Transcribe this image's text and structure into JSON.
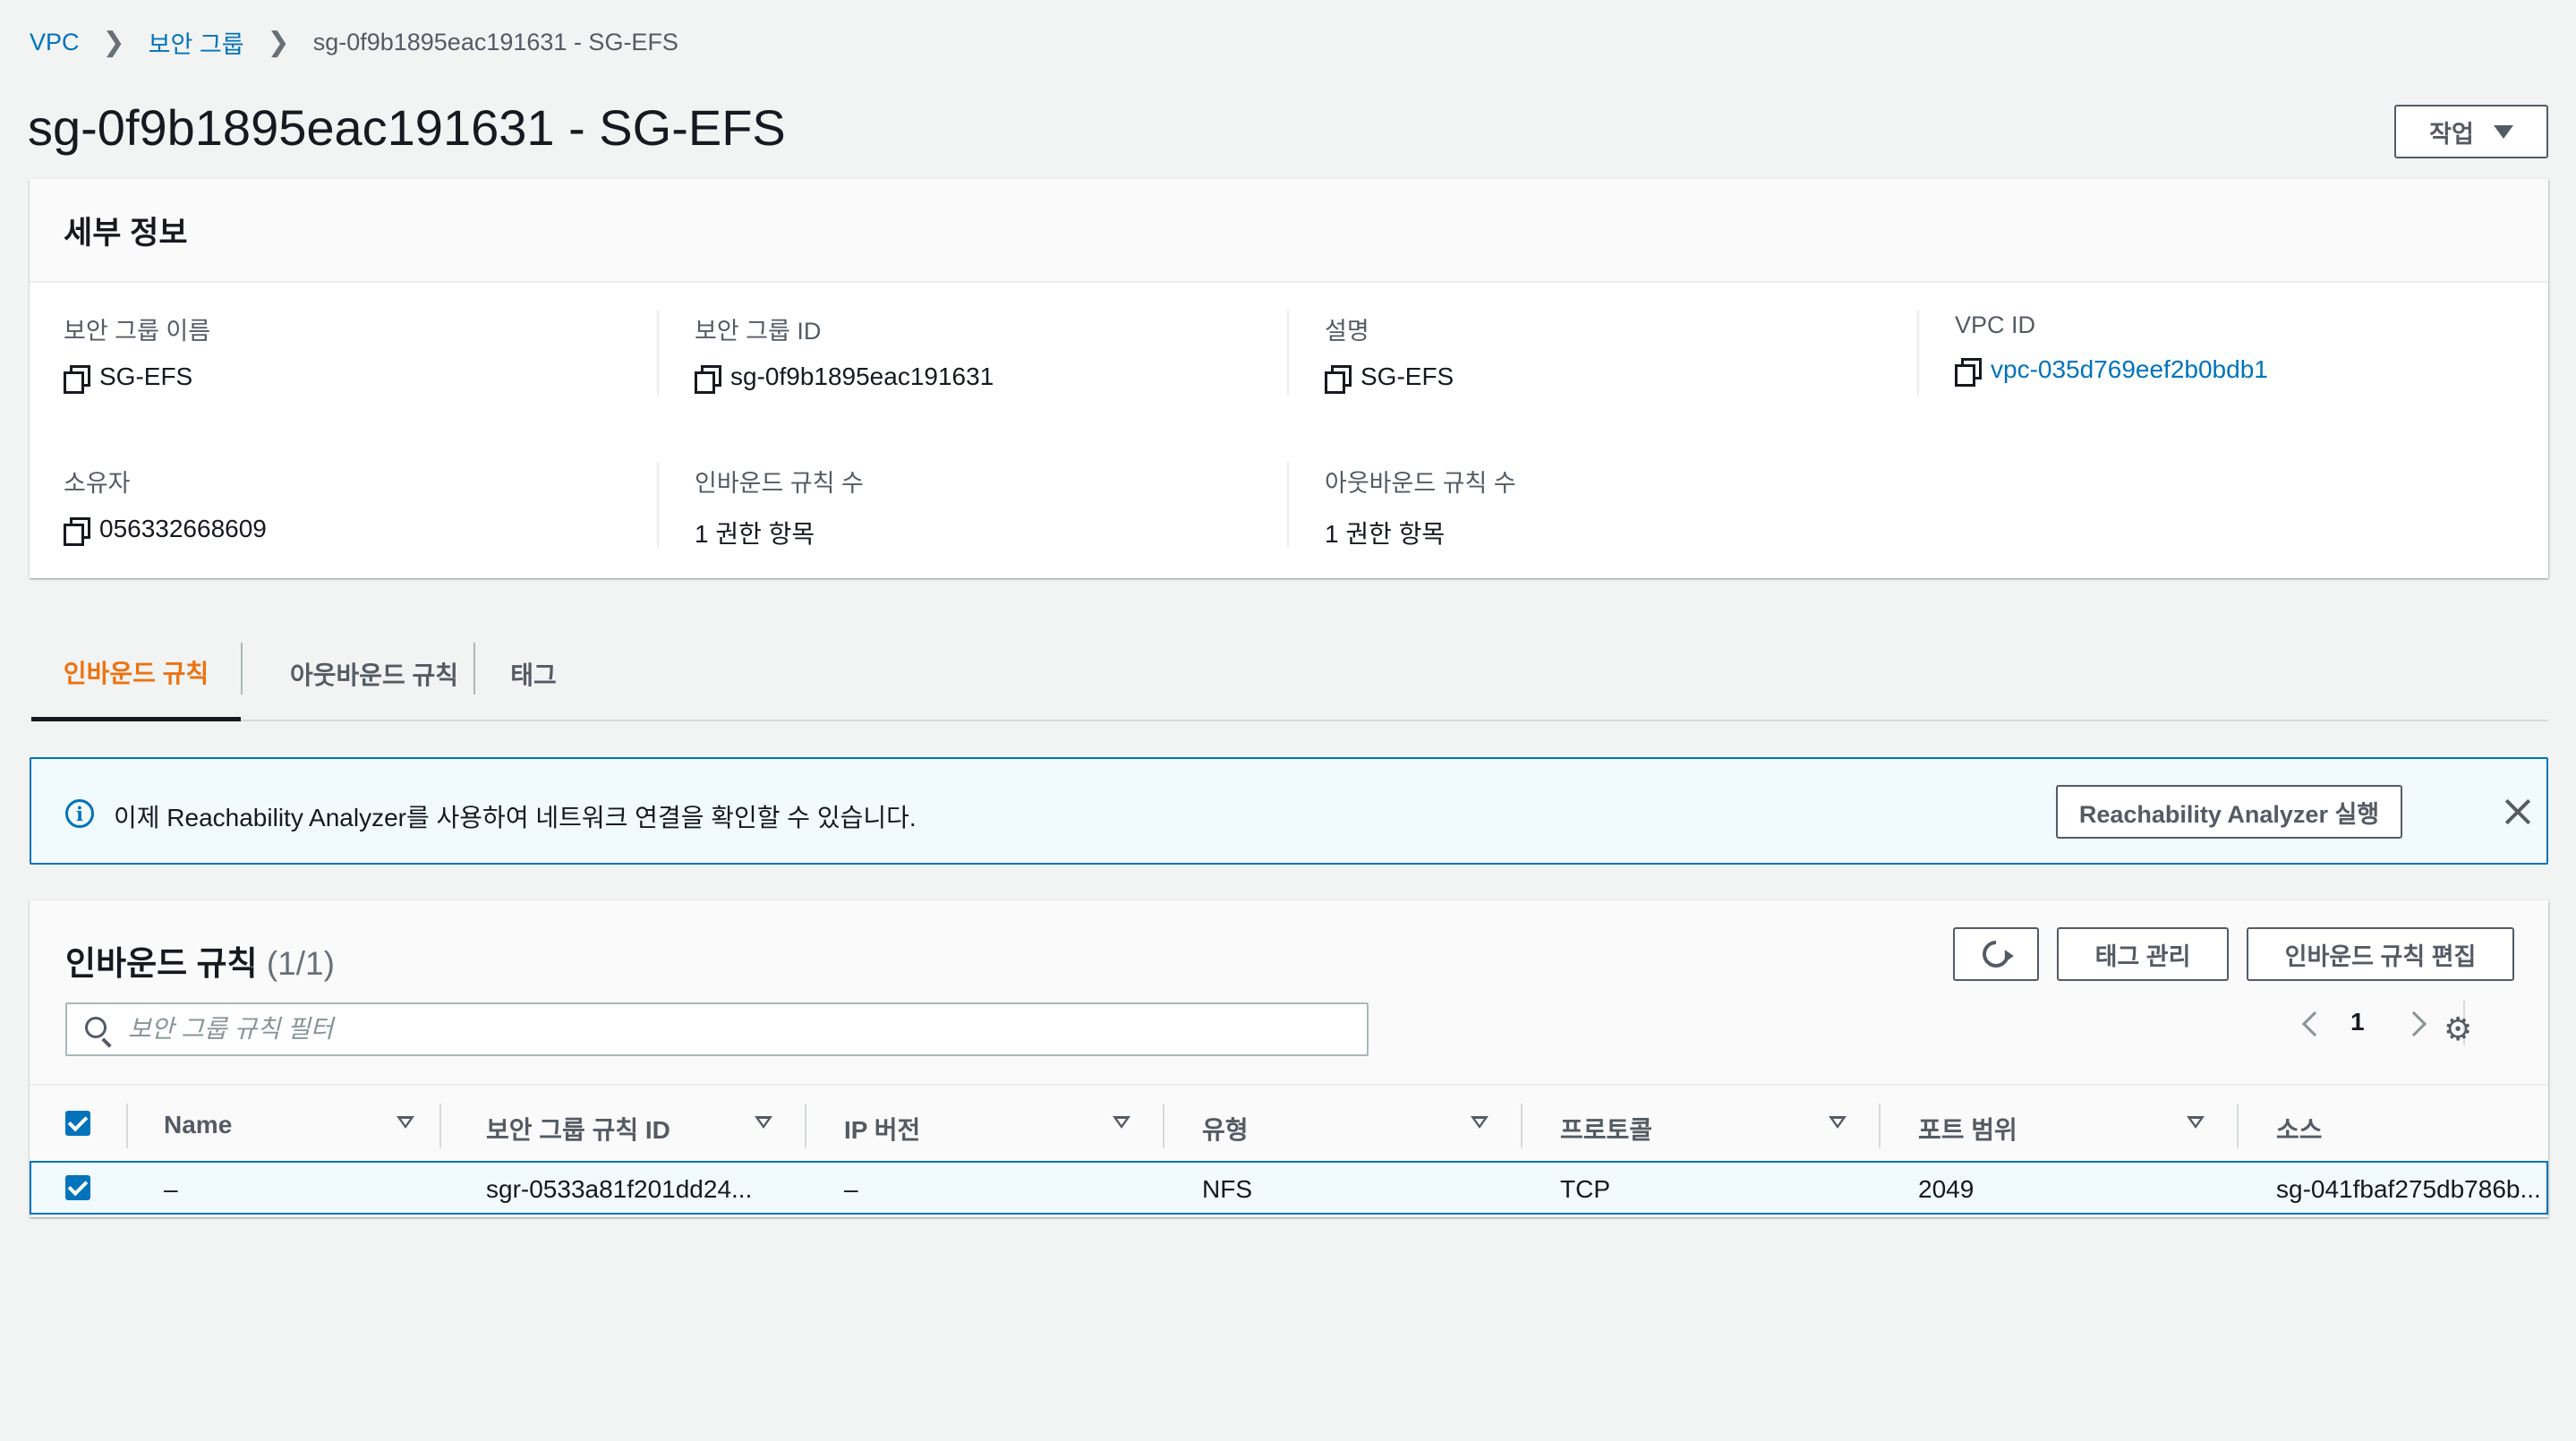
{
  "breadcrumb": {
    "items": [
      "VPC",
      "보안 그룹"
    ],
    "current": "sg-0f9b1895eac191631 - SG-EFS"
  },
  "page": {
    "title": "sg-0f9b1895eac191631 - SG-EFS",
    "actions_label": "작업"
  },
  "details": {
    "header": "세부 정보",
    "fields": [
      {
        "label": "보안 그룹 이름",
        "value": "SG-EFS"
      },
      {
        "label": "보안 그룹 ID",
        "value": "sg-0f9b1895eac191631"
      },
      {
        "label": "설명",
        "value": "SG-EFS"
      },
      {
        "label": "VPC ID",
        "value": "vpc-035d769eef2b0bdb1"
      },
      {
        "label": "소유자",
        "value": "056332668609"
      },
      {
        "label": "인바운드 규칙 수",
        "value": "1 권한 항목"
      },
      {
        "label": "아웃바운드 규칙 수",
        "value": "1 권한 항목"
      }
    ]
  },
  "tabs": [
    {
      "label": "인바운드 규칙",
      "active": true
    },
    {
      "label": "아웃바운드 규칙",
      "active": false
    },
    {
      "label": "태그",
      "active": false
    }
  ],
  "alert": {
    "text": "이제 Reachability Analyzer를 사용하여 네트워크 연결을 확인할 수 있습니다.",
    "button": "Reachability Analyzer 실행"
  },
  "rules": {
    "title": "인바운드 규칙",
    "count": "(1/1)",
    "tag_button": "태그 관리",
    "edit_button": "인바운드 규칙 편집",
    "search_placeholder": "보안 그룹 규칙 필터",
    "page": "1",
    "columns": [
      "Name",
      "보안 그룹 규칙 ID",
      "IP 버전",
      "유형",
      "프로토콜",
      "포트 범위",
      "소스"
    ],
    "rows": [
      {
        "name": "–",
        "rule_id": "sgr-0533a81f201dd24...",
        "ip_version": "–",
        "type": "NFS",
        "protocol": "TCP",
        "port": "2049",
        "source": "sg-041fbaf275db786b..."
      }
    ]
  },
  "colors": {
    "link": "#0073bb",
    "active_tab": "#ec7211",
    "selected_row_bg": "#f1faff"
  }
}
